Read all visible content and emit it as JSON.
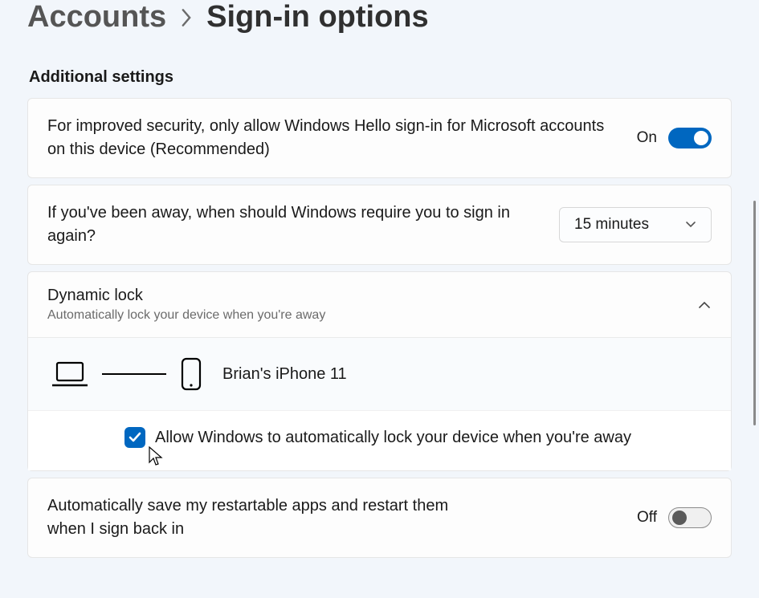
{
  "breadcrumb": {
    "parent": "Accounts",
    "current": "Sign-in options"
  },
  "section_title": "Additional settings",
  "rows": {
    "hello": {
      "text": "For improved security, only allow Windows Hello sign-in for Microsoft accounts on this device (Recommended)",
      "state_label": "On",
      "state": true
    },
    "away": {
      "text": "If you've been away, when should Windows require you to sign in again?",
      "dropdown_value": "15 minutes"
    },
    "dynamic_lock": {
      "title": "Dynamic lock",
      "subtitle": "Automatically lock your device when you're away",
      "device_name": "Brian's iPhone 11",
      "checkbox_label": "Allow Windows to automatically lock your device when you're away",
      "checkbox_checked": true
    },
    "restartable": {
      "text": "Automatically save my restartable apps and restart them when I sign back in",
      "state_label": "Off",
      "state": false
    }
  }
}
